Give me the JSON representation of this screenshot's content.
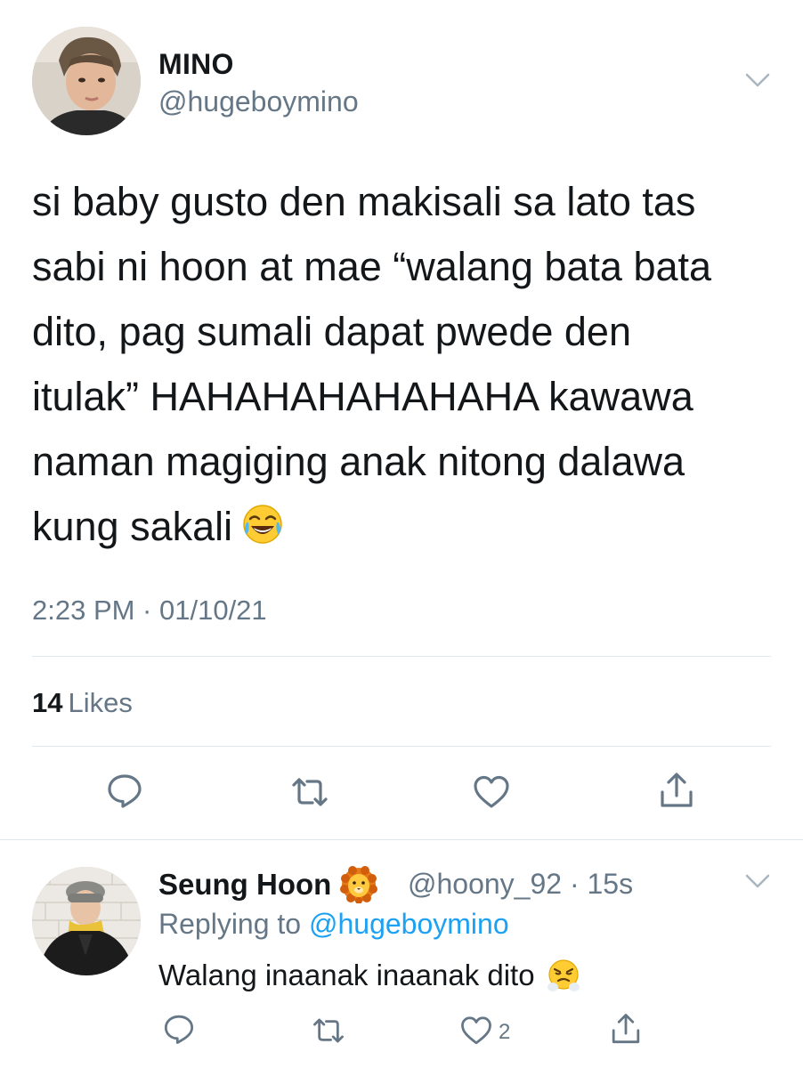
{
  "tweet": {
    "author_name": "MINO",
    "author_handle": "@hugeboymino",
    "text": "si baby gusto den makisali sa lato tas\nsabi ni hoon at mae “walang bata bata\ndito, pag sumali dapat pwede den\nitulak” HAHAHAHAHAHAHA kawawa\nnaman magiging anak nitong dalawa\nkung sakali",
    "emoji": "face-with-tears-of-joy",
    "timestamp": "2:23 PM · 01/10/21",
    "likes_count": "14",
    "likes_label": "Likes"
  },
  "reply": {
    "author_name": "Seung Hoon",
    "author_badge": "lion-face-emoji",
    "author_handle": "@hoony_92",
    "time": "15s",
    "meta": "@hoony_92 · 15s",
    "replying_prefix": "Replying to",
    "replying_mention": "@hugeboymino",
    "text": "Walang inaanak inaanak dito",
    "emoji": "face-with-steam-from-nose",
    "like_count": "2"
  },
  "colors": {
    "text_primary": "#14171a",
    "text_secondary": "#657786",
    "link": "#1da1f2",
    "divider": "#e1e8ed"
  },
  "icons": {
    "reply": "comment-icon",
    "retweet": "retweet-icon",
    "like": "heart-icon",
    "share": "share-icon",
    "menu": "chevron-down-icon"
  }
}
